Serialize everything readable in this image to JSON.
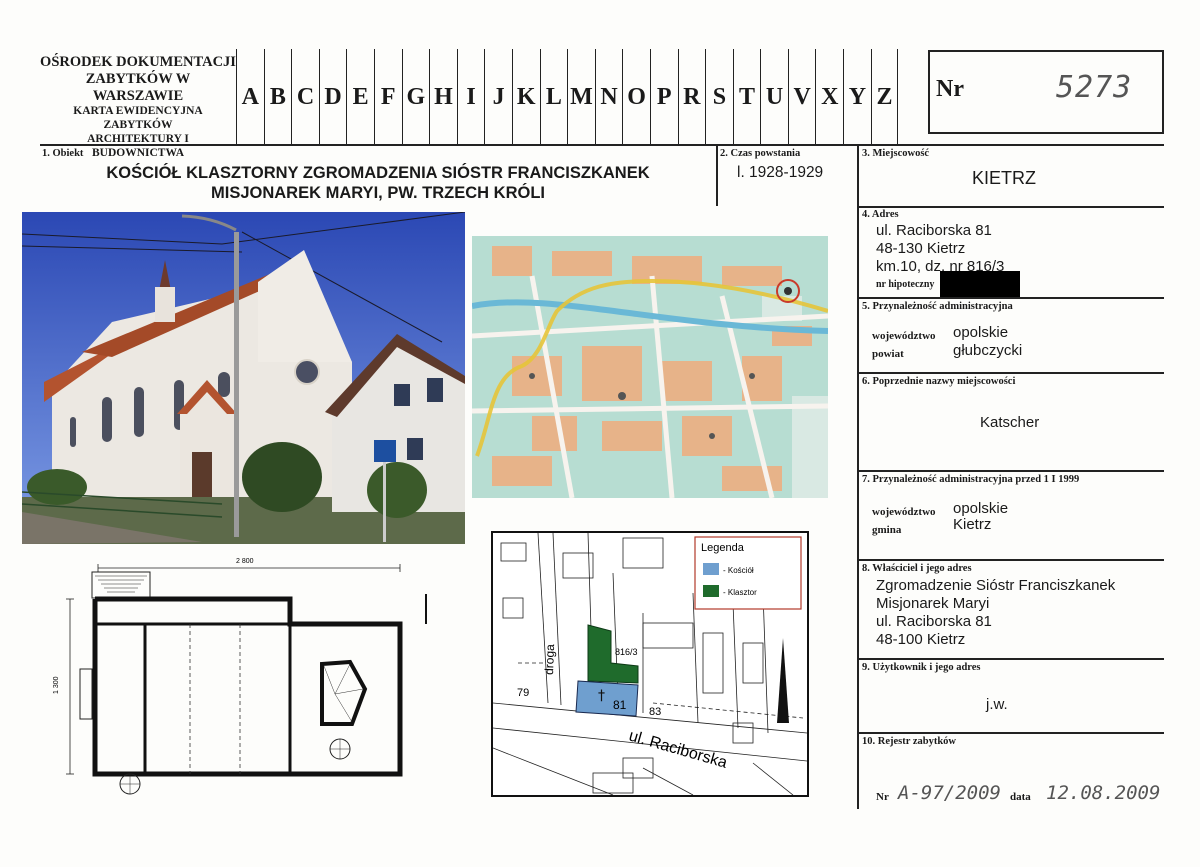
{
  "header": {
    "org_line1": "OŚRODEK DOKUMENTACJI",
    "org_line2": "ZABYTKÓW W WARSZAWIE",
    "card_line1": "KARTA EWIDENCYJNA ZABYTKÓW",
    "card_line2": "ARCHITEKTURY I BUDOWNICTWA",
    "letters": [
      "A",
      "B",
      "C",
      "D",
      "E",
      "F",
      "G",
      "H",
      "I",
      "J",
      "K",
      "L",
      "M",
      "N",
      "O",
      "P",
      "R",
      "S",
      "T",
      "U",
      "V",
      "X",
      "Y",
      "Z"
    ],
    "nr_label": "Nr",
    "nr_value": "5273"
  },
  "obiekt": {
    "label": "1. Obiekt",
    "title_line1": "KOŚCIÓŁ KLASZTORNY ZGROMADZENIA SIÓSTR FRANCISZKANEK",
    "title_line2": "MISJONAREK MARYI, PW. TRZECH KRÓLI"
  },
  "czas": {
    "label": "2. Czas powstania",
    "value": "l. 1928-1929"
  },
  "miejscowosc": {
    "label": "3. Miejscowość",
    "value": "KIETRZ"
  },
  "adres": {
    "label": "4. Adres",
    "line1": "ul. Raciborska 81",
    "line2": "48-130 Kietrz",
    "line3": "km.10, dz. nr 816/3",
    "hipoteczny": "nr hipoteczny"
  },
  "przynaleznosc": {
    "label": "5. Przynależność administracyjna",
    "woj_label": "województwo",
    "woj_value": "opolskie",
    "powiat_label": "powiat",
    "powiat_value": "głubczycki"
  },
  "poprzednie": {
    "label": "6. Poprzednie nazwy miejscowości",
    "value": "Katscher"
  },
  "przynaleznosc_przed": {
    "label": "7. Przynależność administracyjna przed 1 I 1999",
    "woj_label": "województwo",
    "woj_value": "opolskie",
    "gmina_label": "gmina",
    "gmina_value": "Kietrz"
  },
  "wlasciciel": {
    "label": "8. Właściciel i jego adres",
    "line1": "Zgromadzenie Sióstr Franciszkanek",
    "line2": "Misjonarek Maryi",
    "line3": "ul. Raciborska 81",
    "line4": "48-100 Kietrz"
  },
  "uzytkownik": {
    "label": "9. Użytkownik i jego adres",
    "value": "j.w."
  },
  "rejestr": {
    "label": "10. Rejestr zabytków",
    "nr_label": "Nr",
    "nr_value": "A-97/2009",
    "data_label": "data",
    "data_value": "12.08.2009"
  },
  "plan": {
    "width_dim": "2 800",
    "height_dim": "1 300"
  },
  "cad_map": {
    "legend_title": "Legenda",
    "legend_church": "- Kościół",
    "legend_monastery": "- Klasztor",
    "parcel": "816/3",
    "number_81": "81",
    "number_79": "79",
    "number_83": "83",
    "street_droga": "droga",
    "street_raciborska": "ul. Raciborska",
    "color_church": "#6f9fcf",
    "color_monastery": "#1f6b2c"
  }
}
